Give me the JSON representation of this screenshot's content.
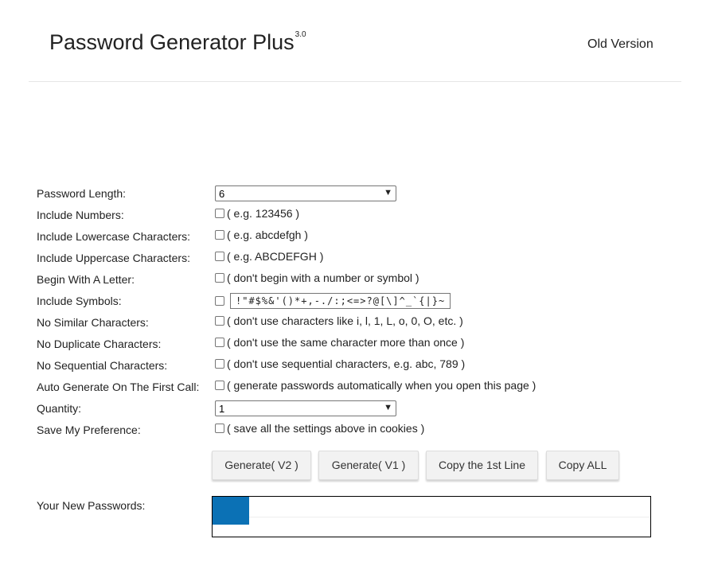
{
  "header": {
    "title": "Password Generator Plus",
    "version": "3.0",
    "old_version": "Old Version"
  },
  "options": [
    {
      "label": "Password Length:",
      "type": "select",
      "value": "6"
    },
    {
      "label": "Include Numbers:",
      "type": "checkbox",
      "hint": "( e.g. 123456 )"
    },
    {
      "label": "Include Lowercase Characters:",
      "type": "checkbox",
      "hint": "( e.g. abcdefgh )"
    },
    {
      "label": "Include Uppercase Characters:",
      "type": "checkbox",
      "hint": "( e.g. ABCDEFGH )"
    },
    {
      "label": "Begin With A Letter:",
      "type": "checkbox",
      "hint": "( don't begin with a number or symbol )"
    },
    {
      "label": "Include Symbols:",
      "type": "symbols",
      "value": "!\"#$%&'()*+,-./:;<=>?@[\\]^_`{|}~"
    },
    {
      "label": "No Similar Characters:",
      "type": "checkbox",
      "hint": "( don't use characters like i, l, 1, L, o, 0, O, etc. )"
    },
    {
      "label": "No Duplicate Characters:",
      "type": "checkbox",
      "hint": "( don't use the same character more than once )"
    },
    {
      "label": "No Sequential Characters:",
      "type": "checkbox",
      "hint": "( don't use sequential characters, e.g. abc, 789 )"
    },
    {
      "label": "Auto Generate On The First Call:",
      "type": "checkbox",
      "hint": "( generate passwords automatically when you open this page )"
    },
    {
      "label": "Quantity:",
      "type": "select",
      "value": "1"
    },
    {
      "label": "Save My Preference:",
      "type": "checkbox",
      "hint": "( save all the settings above in cookies )"
    }
  ],
  "buttons": {
    "generate_v2": "Generate( V2 )",
    "generate_v1": "Generate( V1 )",
    "copy_first": "Copy the 1st Line",
    "copy_all": "Copy ALL"
  },
  "output": {
    "label": "Your New Passwords:",
    "accent_color": "#0b71b5"
  }
}
